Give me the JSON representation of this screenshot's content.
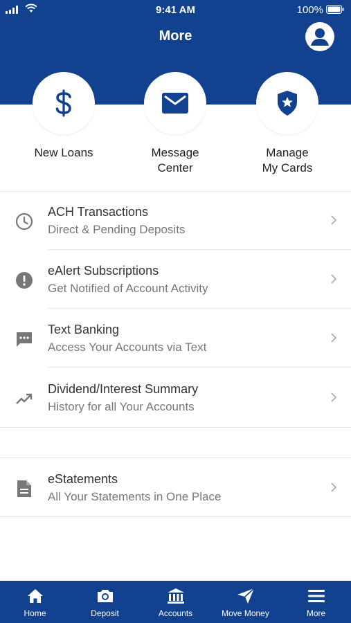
{
  "status_bar": {
    "time": "9:41 AM",
    "battery": "100%"
  },
  "header": {
    "title": "More"
  },
  "quick_actions": [
    {
      "label": "New Loans",
      "icon": "dollar-icon"
    },
    {
      "label": "Message\nCenter",
      "icon": "envelope-icon"
    },
    {
      "label": "Manage\nMy Cards",
      "icon": "shield-star-icon"
    }
  ],
  "menu": [
    {
      "title": "ACH Transactions",
      "subtitle": "Direct & Pending Deposits",
      "icon": "clock-icon"
    },
    {
      "title": "eAlert Subscriptions",
      "subtitle": "Get Notified of Account Activity",
      "icon": "alert-icon"
    },
    {
      "title": "Text Banking",
      "subtitle": "Access Your Accounts via Text",
      "icon": "chat-icon"
    },
    {
      "title": "Dividend/Interest Summary",
      "subtitle": "History for all Your Accounts",
      "icon": "trending-icon"
    }
  ],
  "menu2": [
    {
      "title": "eStatements",
      "subtitle": "All Your Statements in One Place",
      "icon": "document-icon"
    }
  ],
  "tabs": [
    {
      "label": "Home",
      "icon": "home-icon"
    },
    {
      "label": "Deposit",
      "icon": "camera-icon"
    },
    {
      "label": "Accounts",
      "icon": "bank-icon"
    },
    {
      "label": "Move Money",
      "icon": "send-icon"
    },
    {
      "label": "More",
      "icon": "menu-icon"
    }
  ],
  "colors": {
    "brand": "#11418f",
    "icon_gray": "#777777"
  }
}
